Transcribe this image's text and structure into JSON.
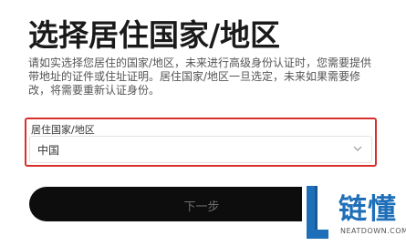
{
  "page": {
    "title": "选择居住国家/地区",
    "description": "请如实选择您居住的国家/地区，未来进行高级身份认证时，您需要提供带地址的证件或住址证明。居住国家/地区一旦选定，未来如果需要修改，将需要重新认证身份。"
  },
  "form": {
    "country_label": "居住国家/地区",
    "country_value": "中国"
  },
  "actions": {
    "next_label": "下一步"
  },
  "watermark": {
    "brand": "链懂",
    "url": "NEATDOWN.COM"
  },
  "colors": {
    "highlight_border": "#d9302c",
    "button_bg": "#0d0d0d",
    "brand_blue": "#1f6fb8"
  }
}
